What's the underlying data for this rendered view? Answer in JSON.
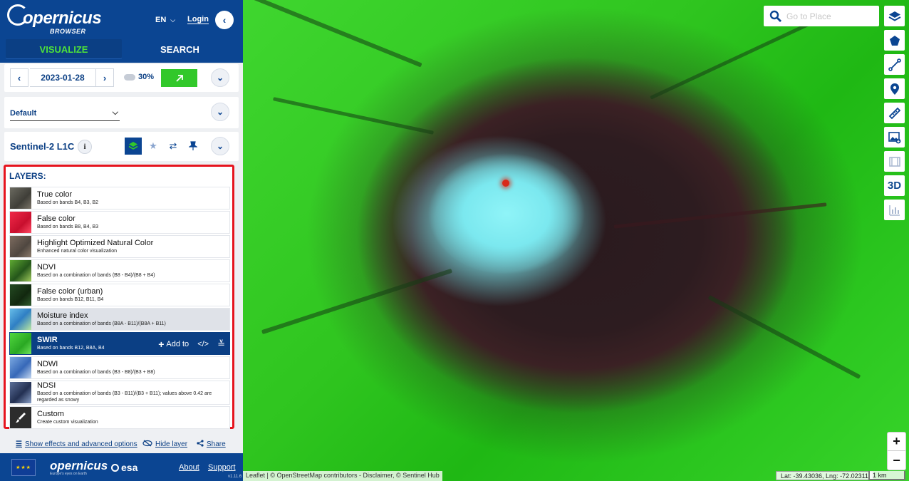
{
  "header": {
    "logo_text": "opernicus",
    "logo_sub": "BROWSER",
    "language": "EN",
    "login": "Login",
    "collapse_icon": "chevron-left-icon"
  },
  "tabs": [
    {
      "label": "VISUALIZE",
      "active": true
    },
    {
      "label": "SEARCH",
      "active": false
    }
  ],
  "date_row": {
    "prev": "‹",
    "date": "2023-01-28",
    "next": "›",
    "cloud_coverage": "30%",
    "go_icon": "arrow-up-right-icon"
  },
  "theme": {
    "selected": "Default"
  },
  "dataset": {
    "name": "Sentinel-2 L1C",
    "info": "i"
  },
  "layers": {
    "title": "LAYERS:",
    "items": [
      {
        "name": "True color",
        "desc": "Based on bands B4, B3, B2",
        "thumb": "#5b5a52"
      },
      {
        "name": "False color",
        "desc": "Based on bands B8, B4, B3",
        "thumb": "#e01c3a"
      },
      {
        "name": "Highlight Optimized Natural Color",
        "desc": "Enhanced natural color visualization",
        "thumb": "#6b5e54"
      },
      {
        "name": "NDVI",
        "desc": "Based on a combination of bands (B8 - B4)/(B8 + B4)",
        "thumb": "#3d7a1f"
      },
      {
        "name": "False color (urban)",
        "desc": "Based on bands B12, B11, B4",
        "thumb": "#1d3b1a"
      },
      {
        "name": "Moisture index",
        "desc": "Based on a combination of bands (B8A - B11)/(B8A + B11)",
        "thumb": "#4aa6d6"
      },
      {
        "name": "SWIR",
        "desc": "Based on bands B12, B8A, B4",
        "thumb": "#3fc938"
      },
      {
        "name": "NDWI",
        "desc": "Based on a combination of bands (B3 - B8)/(B3 + B8)",
        "thumb": "#5c8fd1"
      },
      {
        "name": "NDSI",
        "desc": "Based on a combination of bands (B3 - B11)/(B3 + B11); values above 0.42 are regarded as snowy",
        "thumb": "#3b4a6a"
      },
      {
        "name": "Custom",
        "desc": "Create custom visualization",
        "thumb": "#2c2c2c"
      }
    ],
    "selected_actions": {
      "add_label": "Add to",
      "code_label": "</>",
      "expand_label": "⌄"
    }
  },
  "options": {
    "effects": "Show effects and advanced options",
    "hide": "Hide layer",
    "share": "Share"
  },
  "footer": {
    "flag_stars": "★★★",
    "logo": "opernicus",
    "logo_sub": "Europe's eyes on Earth",
    "esa": "esa",
    "about": "About",
    "support": "Support",
    "version": "v1.11.6"
  },
  "map": {
    "search_placeholder": "Go to Place",
    "three_d": "3D",
    "zoom_in": "+",
    "zoom_out": "−",
    "attribution": "Leaflet | © OpenStreetMap contributors - Disclaimer, © Sentinel Hub",
    "coords": "Lat: -39.43036, Lng: -72.02311",
    "scale": "1 km",
    "accent_blue": "#0b4592",
    "accent_green": "#32c82a",
    "highlight_red": "#e6141e"
  }
}
